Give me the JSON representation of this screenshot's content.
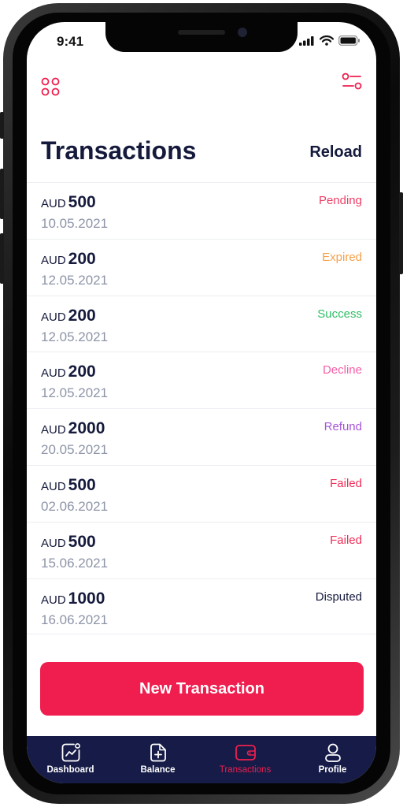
{
  "status_bar": {
    "time": "9:41"
  },
  "header": {
    "title": "Transactions",
    "reload_label": "Reload"
  },
  "transactions": [
    {
      "currency": "AUD",
      "amount": "500",
      "date": "10.05.2021",
      "status": "Pending",
      "status_color": "#ef3e66"
    },
    {
      "currency": "AUD",
      "amount": "200",
      "date": "12.05.2021",
      "status": "Expired",
      "status_color": "#f5a04a"
    },
    {
      "currency": "AUD",
      "amount": "200",
      "date": "12.05.2021",
      "status": "Success",
      "status_color": "#2dbd64"
    },
    {
      "currency": "AUD",
      "amount": "200",
      "date": "12.05.2021",
      "status": "Decline",
      "status_color": "#f45fa8"
    },
    {
      "currency": "AUD",
      "amount": "2000",
      "date": "20.05.2021",
      "status": "Refund",
      "status_color": "#a654d8"
    },
    {
      "currency": "AUD",
      "amount": "500",
      "date": "02.06.2021",
      "status": "Failed",
      "status_color": "#ef2e58"
    },
    {
      "currency": "AUD",
      "amount": "500",
      "date": "15.06.2021",
      "status": "Failed",
      "status_color": "#ef2e58"
    },
    {
      "currency": "AUD",
      "amount": "1000",
      "date": "16.06.2021",
      "status": "Disputed",
      "status_color": "#151a3c"
    }
  ],
  "primary_action": {
    "label": "New Transaction"
  },
  "tab_bar": {
    "active_tab": "transactions",
    "tabs": [
      {
        "id": "dashboard",
        "label": "Dashboard",
        "icon": "chart-icon"
      },
      {
        "id": "balance",
        "label": "Balance",
        "icon": "document-plus-icon"
      },
      {
        "id": "transactions",
        "label": "Transactions",
        "icon": "wallet-icon"
      },
      {
        "id": "profile",
        "label": "Profile",
        "icon": "user-icon"
      }
    ]
  },
  "colors": {
    "accent": "#ef1e4e",
    "navy": "#151a3c",
    "tab_bar_bg": "#161c47",
    "date_text": "#8d94a8"
  }
}
